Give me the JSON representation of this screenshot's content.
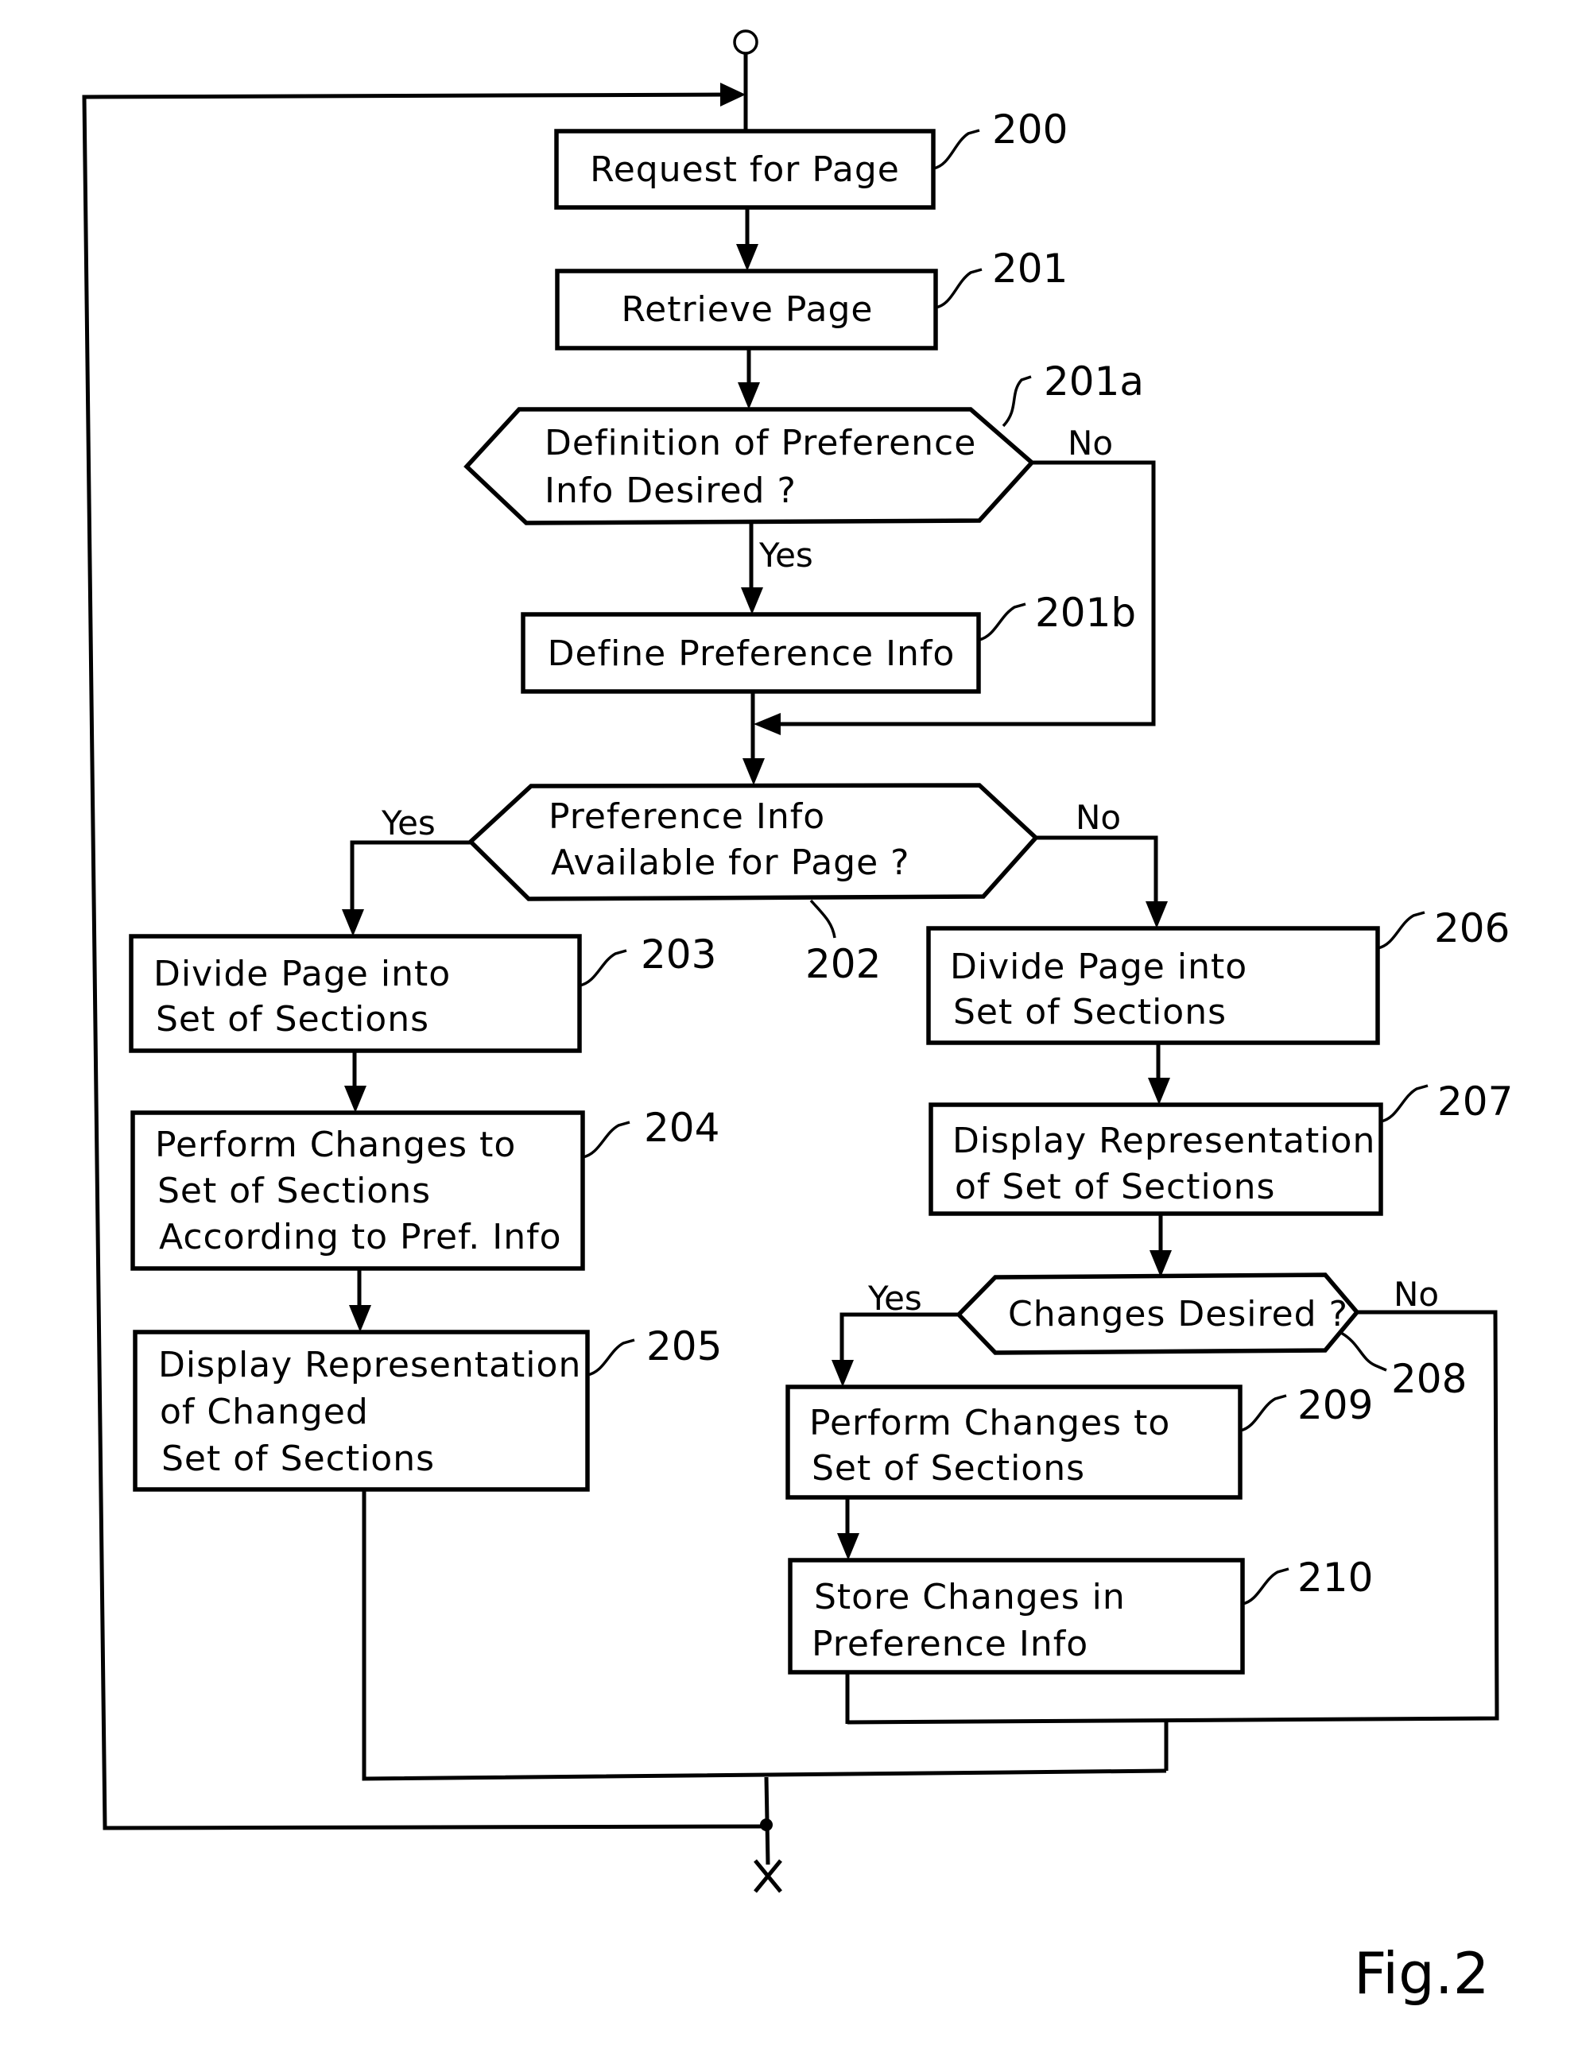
{
  "figure": {
    "caption": "Fig.2",
    "type": "flowchart"
  },
  "nodes": {
    "n200": {
      "ref": "200",
      "shape": "process",
      "lines": [
        "Request for Page"
      ]
    },
    "n201": {
      "ref": "201",
      "shape": "process",
      "lines": [
        "Retrieve Page"
      ]
    },
    "n201a": {
      "ref": "201a",
      "shape": "decision",
      "lines": [
        "Definition of Preference",
        "Info Desired ?"
      ]
    },
    "n201b": {
      "ref": "201b",
      "shape": "process",
      "lines": [
        "Define Preference Info"
      ]
    },
    "n202": {
      "ref": "202",
      "shape": "decision",
      "lines": [
        "Preference Info",
        "Available for Page ?"
      ]
    },
    "n203": {
      "ref": "203",
      "shape": "process",
      "lines": [
        "Divide Page into",
        "Set of Sections"
      ]
    },
    "n204": {
      "ref": "204",
      "shape": "process",
      "lines": [
        "Perform Changes to",
        "Set of Sections",
        "According to Pref. Info"
      ]
    },
    "n205": {
      "ref": "205",
      "shape": "process",
      "lines": [
        "Display Representation",
        "of Changed",
        "Set of Sections"
      ]
    },
    "n206": {
      "ref": "206",
      "shape": "process",
      "lines": [
        "Divide Page into",
        "Set of Sections"
      ]
    },
    "n207": {
      "ref": "207",
      "shape": "process",
      "lines": [
        "Display Representation",
        "of Set of Sections"
      ]
    },
    "n208": {
      "ref": "208",
      "shape": "decision",
      "lines": [
        "Changes Desired ?"
      ]
    },
    "n209": {
      "ref": "209",
      "shape": "process",
      "lines": [
        "Perform Changes to",
        "Set of Sections"
      ]
    },
    "n210": {
      "ref": "210",
      "shape": "process",
      "lines": [
        "Store Changes in",
        "Preference Info"
      ]
    }
  },
  "branch_labels": {
    "n201a_no": "No",
    "n201a_yes": "Yes",
    "n202_yes": "Yes",
    "n202_no": "No",
    "n208_yes": "Yes",
    "n208_no": "No"
  },
  "edges": [
    {
      "from": "start",
      "to": "n200"
    },
    {
      "from": "n200",
      "to": "n201"
    },
    {
      "from": "n201",
      "to": "n201a"
    },
    {
      "from": "n201a",
      "to": "n201b",
      "label": "Yes"
    },
    {
      "from": "n201a",
      "to": "n202",
      "label": "No"
    },
    {
      "from": "n201b",
      "to": "n202"
    },
    {
      "from": "n202",
      "to": "n203",
      "label": "Yes"
    },
    {
      "from": "n202",
      "to": "n206",
      "label": "No"
    },
    {
      "from": "n203",
      "to": "n204"
    },
    {
      "from": "n204",
      "to": "n205"
    },
    {
      "from": "n206",
      "to": "n207"
    },
    {
      "from": "n207",
      "to": "n208"
    },
    {
      "from": "n208",
      "to": "n209",
      "label": "Yes"
    },
    {
      "from": "n208",
      "to": "merge",
      "label": "No"
    },
    {
      "from": "n209",
      "to": "n210"
    },
    {
      "from": "n210",
      "to": "merge"
    },
    {
      "from": "n205",
      "to": "merge"
    },
    {
      "from": "merge",
      "to": "n200",
      "note": "loop back"
    },
    {
      "from": "merge",
      "to": "end"
    }
  ]
}
